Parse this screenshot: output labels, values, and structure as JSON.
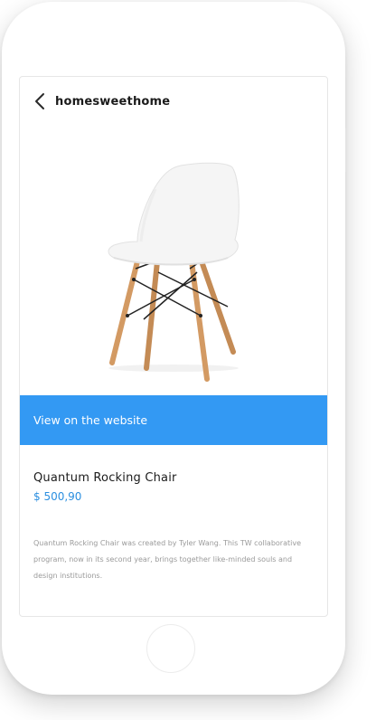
{
  "header": {
    "back_icon": "chevron-left-icon",
    "title": "homesweethome"
  },
  "product": {
    "image_alt": "white chair with wooden legs",
    "cta_label": "View on the website",
    "name": "Quantum Rocking Chair",
    "price": "$ 500,90",
    "description": "Quantum Rocking Chair was created by Tyler Wang. This TW collaborative program, now in its second year, brings together like-minded souls and design institutions."
  },
  "colors": {
    "accent": "#3399f3",
    "price": "#2b8fe0",
    "text": "#1b1b1b",
    "muted": "#9a9a9a"
  }
}
